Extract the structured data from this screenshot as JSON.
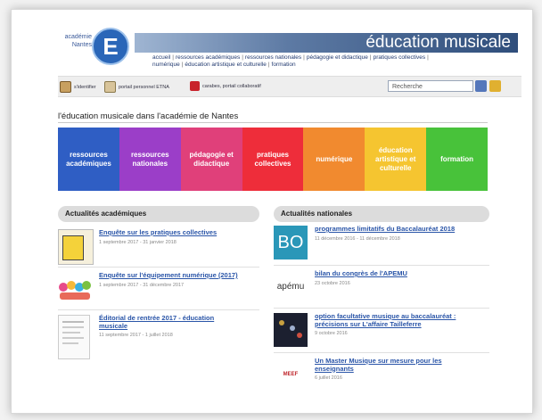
{
  "header": {
    "logo_text_1": "académie",
    "logo_text_2": "Nantes",
    "logo_letter": "E",
    "site_title": "éducation musicale",
    "nav": [
      "accueil",
      "ressources académiques",
      "ressources nationales",
      "pédagogie et didactique",
      "pratiques collectives",
      "numérique",
      "éducation artistique et culturelle",
      "formation"
    ]
  },
  "toolbar": {
    "login": "s'identifier",
    "portal": "portail personnel ETNA",
    "collab": "carabes, portail collaboratif",
    "search_placeholder": "Recherche"
  },
  "main": {
    "section_title": "l'éducation musicale dans l'académie de Nantes",
    "tiles": [
      {
        "label": "ressources académiques",
        "color": "#2f5ec4"
      },
      {
        "label": "ressources nationales",
        "color": "#9b3ec8"
      },
      {
        "label": "pédagogie et didactique",
        "color": "#e0407a"
      },
      {
        "label": "pratiques collectives",
        "color": "#ee2d3a"
      },
      {
        "label": "numérique",
        "color": "#f18a2f"
      },
      {
        "label": "éducation artistique et culturelle",
        "color": "#f5c530"
      },
      {
        "label": "formation",
        "color": "#48c23a"
      }
    ]
  },
  "academic": {
    "heading": "Actualités académiques",
    "items": [
      {
        "title": "Enquête sur les pratiques collectives",
        "date": "1 septembre 2017 - 31 janvier 2018"
      },
      {
        "title": "Enquête sur l'équipement numérique (2017)",
        "date": "1 septembre 2017 - 31 décembre 2017"
      },
      {
        "title": "Éditorial de rentrée 2017 - éducation musicale",
        "date": "11 septembre 2017 - 1 juillet 2018"
      }
    ]
  },
  "national": {
    "heading": "Actualités nationales",
    "items": [
      {
        "title": "programmes limitatifs du Baccalauréat 2018",
        "date": "11 décembre 2016 - 11 décembre 2018",
        "thumb_text": "BO"
      },
      {
        "title": "bilan du congrès de l'APEMU",
        "date": "23 octobre 2016",
        "thumb_text": "apému"
      },
      {
        "title": "option facultative musique au baccalauréat : précisions sur L'affaire Tailleferre",
        "date": "9 octobre 2016",
        "thumb_text": ""
      },
      {
        "title": "Un Master Musique sur mesure pour les enseignants",
        "date": "6 juillet 2016",
        "thumb_text": "MEEF"
      }
    ]
  }
}
